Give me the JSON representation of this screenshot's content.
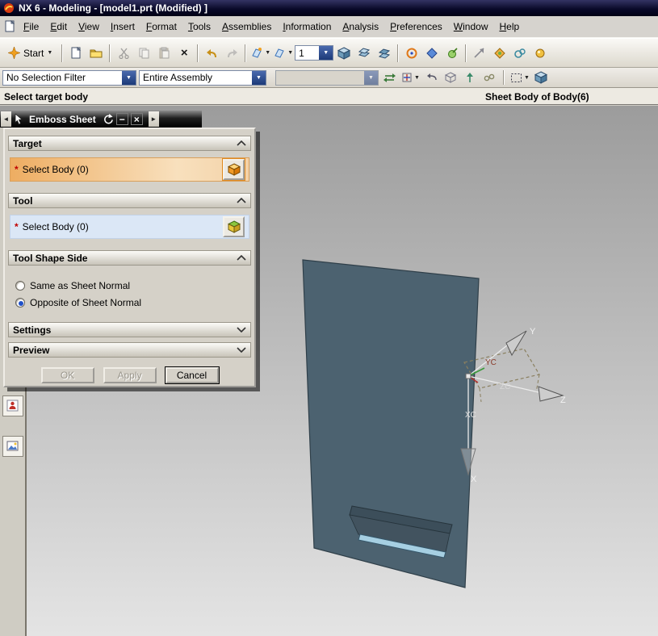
{
  "window": {
    "title": "NX 6 - Modeling - [model1.prt (Modified) ]"
  },
  "menu": {
    "items": [
      "File",
      "Edit",
      "View",
      "Insert",
      "Format",
      "Tools",
      "Assemblies",
      "Information",
      "Analysis",
      "Preferences",
      "Window",
      "Help"
    ]
  },
  "toolbar1": {
    "start_label": "Start",
    "view_scale": "1"
  },
  "toolbar2": {
    "selection_filter": "No Selection Filter",
    "selection_scope": "Entire Assembly"
  },
  "statusbar": {
    "prompt": "Select target body",
    "selection": "Sheet Body of Body(6)"
  },
  "dialog": {
    "title": "Emboss Sheet",
    "required_marker": "*",
    "target": {
      "header": "Target",
      "select_label": "Select Body (0)"
    },
    "tool": {
      "header": "Tool",
      "select_label": "Select Body (0)"
    },
    "tool_shape_side": {
      "header": "Tool Shape Side",
      "options": [
        {
          "label": "Same as Sheet Normal",
          "selected": false
        },
        {
          "label": "Opposite of Sheet Normal",
          "selected": true
        }
      ]
    },
    "settings": {
      "header": "Settings"
    },
    "preview": {
      "header": "Preview"
    },
    "buttons": {
      "ok": "OK",
      "apply": "Apply",
      "cancel": "Cancel"
    }
  },
  "graphics": {
    "labels": {
      "x": "X",
      "y": "Y",
      "z": "Z",
      "xc": "XC",
      "yc": "YC",
      "zc": "ZC"
    }
  },
  "icons": {
    "dropdown_caret": "▼",
    "back": "◄",
    "forward": "►",
    "minimize": "−",
    "close": "×"
  },
  "colors": {
    "target_highlight": "#eead62",
    "tool_highlight": "#dbe7f6",
    "sheet_body": "#4c6270",
    "slot_face": "#a6cfe2",
    "titlebar": "#0a0a2a",
    "chrome": "#d6d3ce"
  }
}
